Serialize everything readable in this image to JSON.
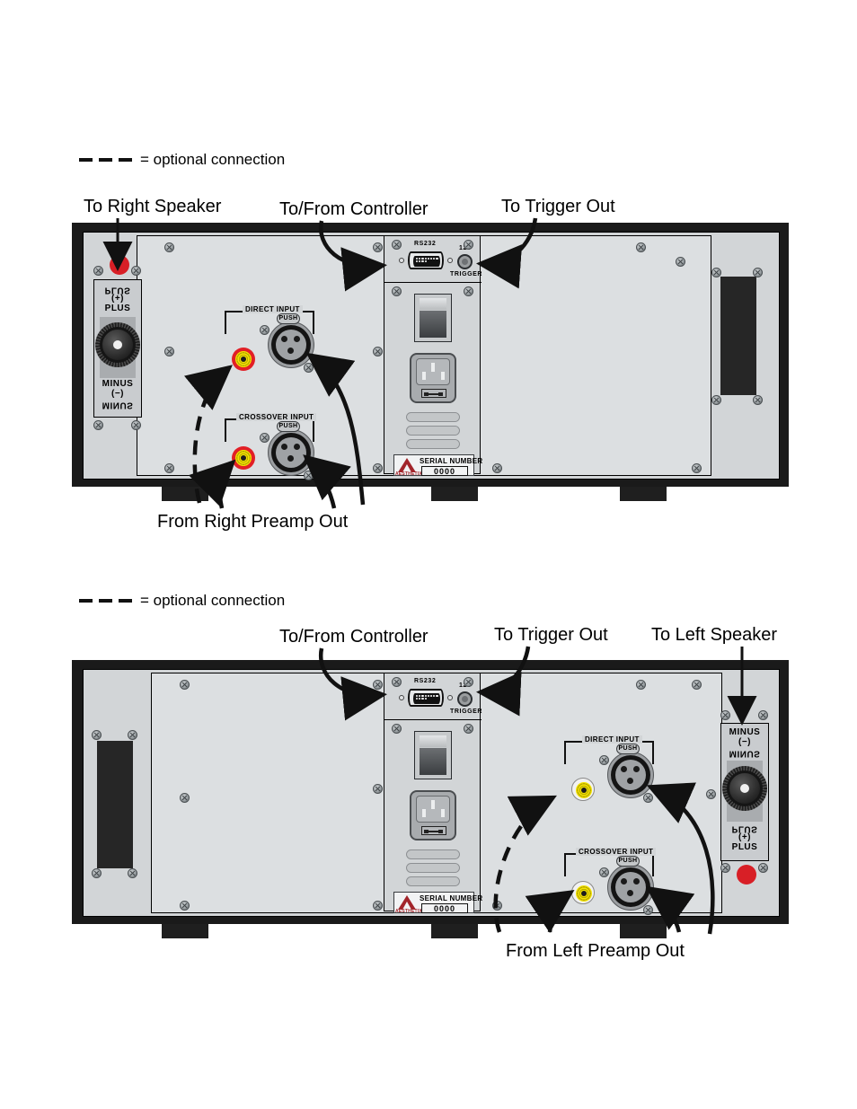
{
  "figure": {
    "type": "rear-panel-connection-diagram",
    "device": "AESTHETIX mono power amplifier rear panel",
    "units": 2
  },
  "legend": {
    "optional_text": "= optional connection",
    "dash_style": "dashed"
  },
  "unit_top": {
    "channel": "Right",
    "callouts": {
      "speaker": "To Right Speaker",
      "controller": "To/From Controller",
      "trigger": "To Trigger Out",
      "preamp": "From Right Preamp Out"
    },
    "binding_post": {
      "top_label_mirror": "PLUS",
      "top_label_sign": "(+)",
      "top_label": "PLUS",
      "bottom_label_mirror": "MINUS",
      "bottom_label_sign": "(−)",
      "bottom_label": "MINUS",
      "red_post_position": "top"
    },
    "inputs": [
      {
        "bracket": "DIRECT INPUT",
        "rca_color": "#e21f26",
        "xlr_tab": "PUSH"
      },
      {
        "bracket": "CROSSOVER INPUT",
        "rca_color": "#e21f26",
        "xlr_tab": "PUSH"
      }
    ],
    "blank_panel_side": "right"
  },
  "unit_bottom": {
    "channel": "Left",
    "callouts": {
      "controller": "To/From Controller",
      "trigger": "To Trigger Out",
      "speaker": "To Left Speaker",
      "preamp": "From Left Preamp Out"
    },
    "binding_post": {
      "top_label_mirror": "MINUS",
      "top_label_sign": "(−)",
      "top_label": "MINUS",
      "bottom_label_mirror": "PLUS",
      "bottom_label_sign": "(+)",
      "bottom_label": "PLUS",
      "red_post_position": "bottom"
    },
    "inputs": [
      {
        "bracket": "DIRECT INPUT",
        "rca_color": "#f2f2f2",
        "xlr_tab": "PUSH"
      },
      {
        "bracket": "CROSSOVER INPUT",
        "rca_color": "#f2f2f2",
        "xlr_tab": "PUSH"
      }
    ],
    "blank_panel_side": "left"
  },
  "control_panel": {
    "rs232_label": "RS232",
    "trigger_volt_label": "12V",
    "trigger_label": "TRIGGER",
    "serial_title": "SERIAL NUMBER",
    "serial_value": "0000",
    "brand": "AESTHETIX",
    "vent_count": 3,
    "db9_pin_count": 9
  },
  "colors": {
    "chassis_black": "#1a1a1a",
    "faceplate": "#d2d5d7",
    "panel": "#dcdfe1",
    "accent_red": "#d81f26",
    "rca_yellow": "#f4e400",
    "logo_red": "#a2252b"
  }
}
